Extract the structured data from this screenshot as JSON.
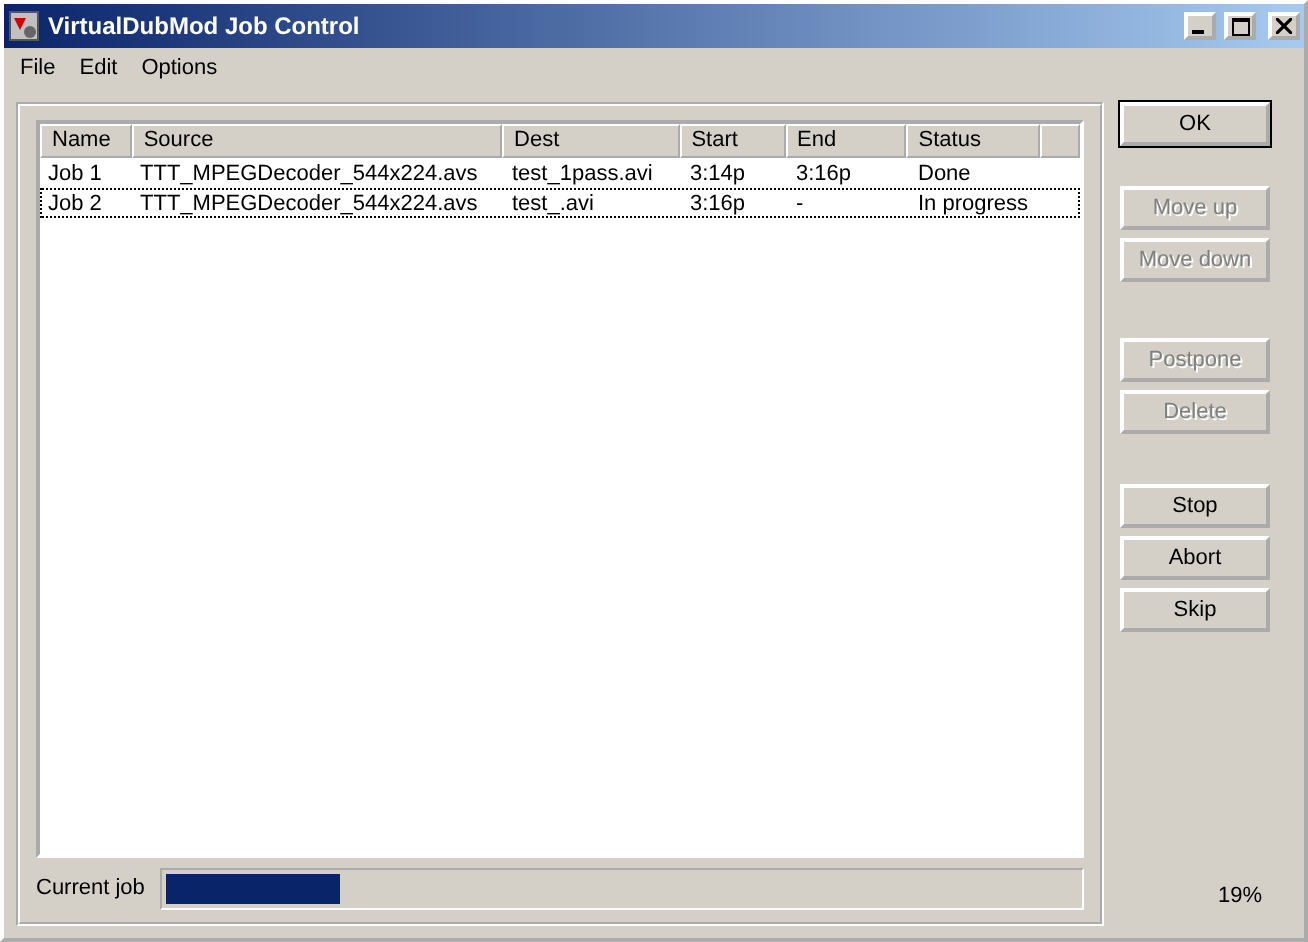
{
  "window": {
    "title": "VirtualDubMod Job Control"
  },
  "menu": [
    "File",
    "Edit",
    "Options"
  ],
  "table": {
    "columns": [
      "Name",
      "Source",
      "Dest",
      "Start",
      "End",
      "Status"
    ],
    "rows": [
      {
        "cells": [
          "Job 1",
          "TTT_MPEGDecoder_544x224.avs",
          "test_1pass.avi",
          "3:14p",
          "3:16p",
          "Done"
        ],
        "selected": false
      },
      {
        "cells": [
          "Job 2",
          "TTT_MPEGDecoder_544x224.avs",
          "test_.avi",
          "3:16p",
          "-",
          "In progress"
        ],
        "selected": true
      }
    ]
  },
  "buttons": [
    {
      "label": "OK",
      "disabled": false,
      "default": true
    },
    {
      "label": "Move up",
      "disabled": true,
      "default": false
    },
    {
      "label": "Move down",
      "disabled": true,
      "default": false
    },
    {
      "label": "Postpone",
      "disabled": true,
      "default": false
    },
    {
      "label": "Delete",
      "disabled": true,
      "default": false
    },
    {
      "label": "Stop",
      "disabled": false,
      "default": false
    },
    {
      "label": "Abort",
      "disabled": false,
      "default": false
    },
    {
      "label": "Skip",
      "disabled": false,
      "default": false
    }
  ],
  "progress": {
    "label": "Current job",
    "level": 0.19,
    "reading": "19%"
  }
}
